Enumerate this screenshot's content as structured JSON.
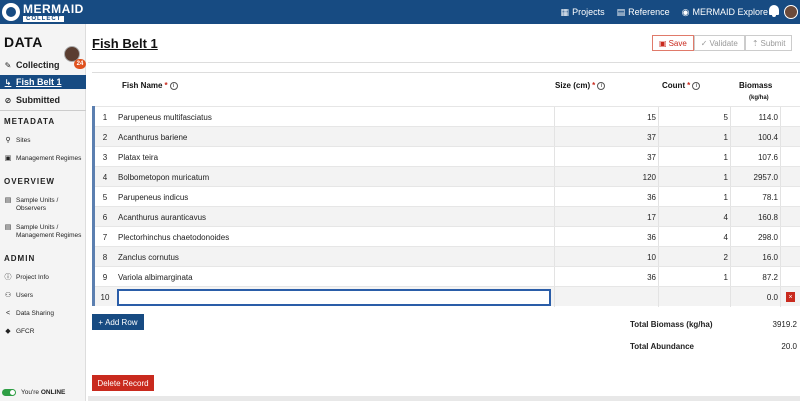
{
  "app": {
    "logo_title": "MERMAID",
    "logo_sub": "COLLECT"
  },
  "topnav": {
    "projects": "Projects",
    "reference": "Reference",
    "explore": "MERMAID Explore"
  },
  "sidebar": {
    "title": "DATA",
    "badge": "24",
    "collecting": "Collecting",
    "active_item": "Fish Belt 1",
    "submitted": "Submitted",
    "metadata_title": "METADATA",
    "sites": "Sites",
    "management_regimes": "Management Regimes",
    "overview_title": "OVERVIEW",
    "su_observers_1": "Sample Units /",
    "su_observers_2": "Observers",
    "su_mr_1": "Sample Units /",
    "su_mr_2": "Management Regimes",
    "admin_title": "ADMIN",
    "project_info": "Project Info",
    "users": "Users",
    "data_sharing": "Data Sharing",
    "gfcr": "GFCR",
    "online_prefix": "You're",
    "online_status": "ONLINE"
  },
  "header": {
    "title": "Fish Belt",
    "title_num": "1",
    "save": "Save",
    "validate": "Validate",
    "submit": "Submit"
  },
  "table": {
    "col_name": "Fish Name",
    "col_size": "Size (cm)",
    "col_count": "Count",
    "col_biomass": "Biomass",
    "col_biomass_unit": "(kg/ha)",
    "required_mark": "*",
    "rows": [
      {
        "n": "1",
        "name": "Parupeneus multifasciatus",
        "size": "15",
        "count": "5",
        "bio": "114.0"
      },
      {
        "n": "2",
        "name": "Acanthurus bariene",
        "size": "37",
        "count": "1",
        "bio": "100.4"
      },
      {
        "n": "3",
        "name": "Platax teira",
        "size": "37",
        "count": "1",
        "bio": "107.6"
      },
      {
        "n": "4",
        "name": "Bolbometopon muricatum",
        "size": "120",
        "count": "1",
        "bio": "2957.0"
      },
      {
        "n": "5",
        "name": "Parupeneus indicus",
        "size": "36",
        "count": "1",
        "bio": "78.1"
      },
      {
        "n": "6",
        "name": "Acanthurus auranticavus",
        "size": "17",
        "count": "4",
        "bio": "160.8"
      },
      {
        "n": "7",
        "name": "Plectorhinchus chaetodonoides",
        "size": "36",
        "count": "4",
        "bio": "298.0"
      },
      {
        "n": "8",
        "name": "Zanclus cornutus",
        "size": "10",
        "count": "2",
        "bio": "16.0"
      },
      {
        "n": "9",
        "name": "Variola albimarginata",
        "size": "36",
        "count": "1",
        "bio": "87.2"
      },
      {
        "n": "10",
        "name": "",
        "size": "",
        "count": "",
        "bio": "0.0"
      }
    ]
  },
  "actions": {
    "add_row": "Add Row",
    "delete_record": "Delete Record",
    "delete_row_x": "×"
  },
  "totals": {
    "biomass_label": "Total Biomass (kg/ha)",
    "biomass_value": "3919.2",
    "abundance_label": "Total Abundance",
    "abundance_value": "20.0"
  },
  "colors": {
    "brand_blue": "#174b82",
    "danger_red": "#c92a1e",
    "online_green": "#2e9e44"
  }
}
